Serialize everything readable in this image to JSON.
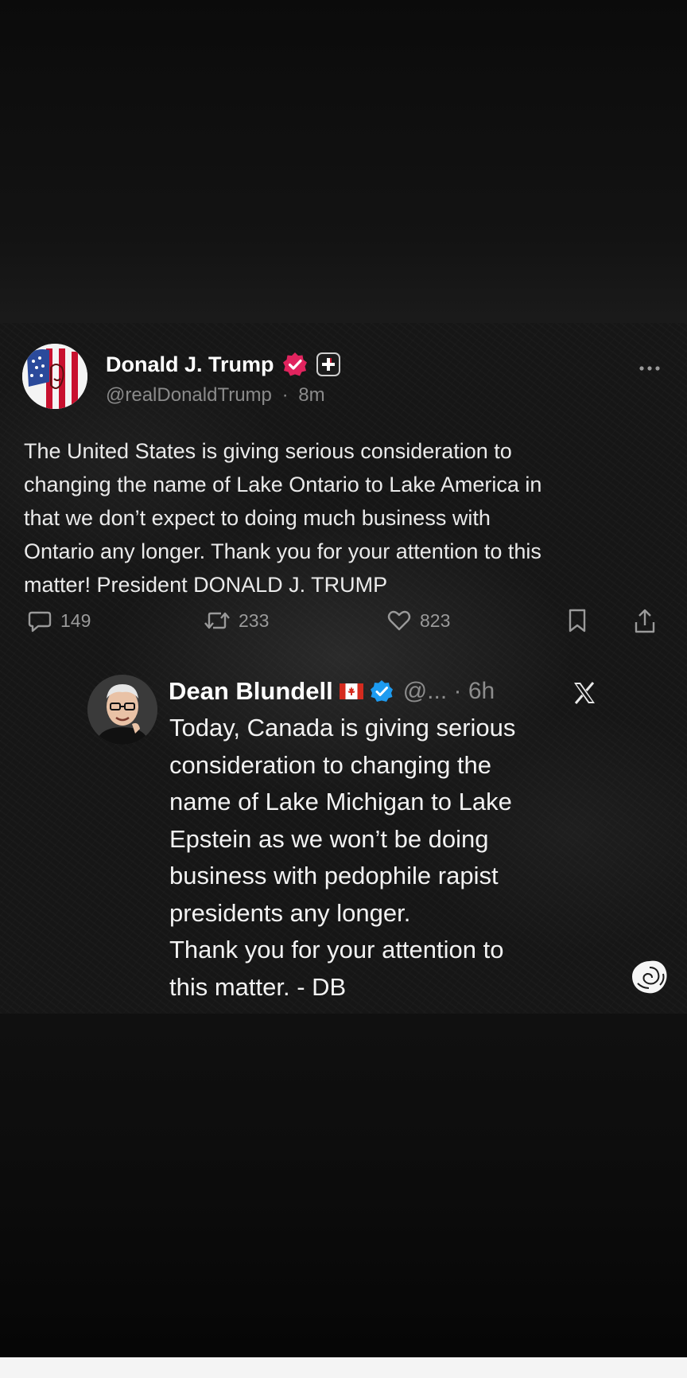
{
  "tweet": {
    "display_name": "Donald J. Trump",
    "handle": "@realDonaldTrump",
    "separator": "·",
    "time": "8m",
    "text": "The United States is giving serious consideration to\nchanging the name of Lake Ontario to Lake America in\nthat we don’t expect to doing much business with\nOntario any longer. Thank you for your attention to this\nmatter! President DONALD J. TRUMP",
    "actions": {
      "replies": "149",
      "reposts": "233",
      "likes": "823"
    },
    "icons": [
      "verified-badge-icon",
      "affiliate-badge-icon",
      "more-icon",
      "reply-icon",
      "repost-icon",
      "like-icon",
      "bookmark-icon",
      "share-icon"
    ],
    "colors": {
      "verified_badge": "#e0245e",
      "name": "#ffffff",
      "handle": "#8b8b8b",
      "body": "#eaeaea"
    }
  },
  "reply": {
    "display_name": "Dean Blundell",
    "flag": "🇨🇦",
    "meta": "@... · 6h",
    "text": "Today, Canada is giving serious\nconsideration to changing the\nname of Lake Michigan to Lake\nEpstein as we won’t be doing\nbusiness with pedophile rapist\npresidents any longer.\nThank you for your attention to\nthis matter. - DB",
    "icons": [
      "canada-flag-icon",
      "verified-badge-icon",
      "x-logo-icon"
    ],
    "colors": {
      "verified_badge": "#1d9bf0"
    }
  },
  "watermark": {
    "icon": "rose-icon"
  }
}
